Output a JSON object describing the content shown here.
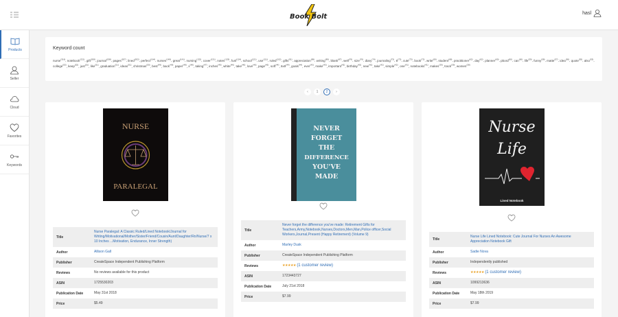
{
  "header": {
    "user_name": "hasl",
    "logo_text": "Book Bolt"
  },
  "sidebar": {
    "items": [
      {
        "label": "Products",
        "icon": "book-icon",
        "active": true
      },
      {
        "label": "Seller",
        "icon": "user-icon"
      },
      {
        "label": "Cloud",
        "icon": "cloud-icon"
      },
      {
        "label": "Favorites",
        "icon": "heart-icon"
      },
      {
        "label": "Keywords",
        "icon": "key-icon"
      }
    ]
  },
  "keyword_count": {
    "title": "Keyword count",
    "keywords": [
      [
        "nurse",
        "316"
      ],
      [
        "notebook",
        "221"
      ],
      [
        "gift",
        "208"
      ],
      [
        "journal",
        "208"
      ],
      [
        "pages",
        "207"
      ],
      [
        "lined",
        "202"
      ],
      [
        "perfect",
        "164"
      ],
      [
        "nurses",
        "149"
      ],
      [
        "great",
        "141"
      ],
      [
        "nursing",
        "132"
      ],
      [
        "cover",
        "131"
      ],
      [
        "notes",
        "129"
      ],
      [
        "funl",
        "124"
      ],
      [
        "school",
        "121"
      ],
      [
        "use",
        "111"
      ],
      [
        "ruled",
        "102"
      ],
      [
        "gifts",
        "91"
      ],
      [
        "appreciation",
        "89"
      ],
      [
        "writing",
        "89"
      ],
      [
        "blank",
        "87"
      ],
      [
        "well",
        "76"
      ],
      [
        "size",
        "76"
      ],
      [
        "diary",
        "74"
      ],
      [
        "journaling",
        "73"
      ],
      [
        "8",
        "73"
      ],
      [
        "cute",
        "73"
      ],
      [
        "book",
        "72"
      ],
      [
        "write",
        "69"
      ],
      [
        "student",
        "68"
      ],
      [
        "practitioner",
        "62"
      ],
      [
        "day",
        "62"
      ],
      [
        "planner",
        "60"
      ],
      [
        "pbord",
        "60"
      ],
      [
        "can",
        "60"
      ],
      [
        "life",
        "59"
      ],
      [
        "funny",
        "58"
      ],
      [
        "matte",
        "57"
      ],
      [
        "idea",
        "56"
      ],
      [
        "quote",
        "55"
      ],
      [
        "also",
        "53"
      ],
      [
        "college",
        "53"
      ],
      [
        "keep",
        "52"
      ],
      [
        "just",
        "51"
      ],
      [
        "like",
        "51"
      ],
      [
        "graduation",
        "51"
      ],
      [
        "ideas",
        "51"
      ],
      [
        "christmas",
        "50"
      ],
      [
        "best",
        "49"
      ],
      [
        "back",
        "49"
      ],
      [
        "paper",
        "48"
      ],
      [
        "x",
        "48"
      ],
      [
        "taking",
        "47"
      ],
      [
        "inches",
        "46"
      ],
      [
        "white",
        "46"
      ],
      [
        "take",
        "46"
      ],
      [
        "love",
        "46"
      ],
      [
        "page",
        "45"
      ],
      [
        "soft",
        "44"
      ],
      [
        "6x9",
        "44"
      ],
      [
        "goals",
        "44"
      ],
      [
        "ever",
        "43"
      ],
      [
        "make",
        "43"
      ],
      [
        "important",
        "42"
      ],
      [
        "birthday",
        "42"
      ],
      [
        "new",
        "42"
      ],
      [
        "take",
        "42"
      ],
      [
        "simple",
        "42"
      ],
      [
        "one",
        "41"
      ],
      [
        "notebooks",
        "41"
      ],
      [
        "makes",
        "39"
      ],
      [
        "track",
        "39"
      ],
      [
        "women",
        "38"
      ]
    ]
  },
  "pagination": {
    "prev": "‹",
    "page1": "1",
    "page2": "2",
    "next": "›"
  },
  "products": [
    {
      "cover_line1": "NURSE",
      "cover_line2": "PARALEGAL",
      "rows": {
        "title_label": "Title",
        "title": "Nurse Paralegal: A Classic Ruled/Lined Notebook/Journal for Writing/Motivational/Mother/Sister/Friend/Cousin/Aunt/Daughter/Rn/Nurse/7 x 10 Inches ...Motivation, Endurance, Inner Strength)",
        "author_label": "Author",
        "author": "Allison Gall",
        "publisher_label": "Publisher",
        "publisher": "CreateSpace Independent Publishing Platform",
        "reviews_label": "Reviews",
        "reviews": "No reviews available for this product",
        "asin_label": "ASIN",
        "asin": "1725530203",
        "pubdate_label": "Publication Date",
        "pubdate": "May 31st 2018",
        "price_label": "Price",
        "price": "$5.49"
      }
    },
    {
      "cover_text": "NEVER FORGET THE DIFFERENCE YOU'VE MADE",
      "rows": {
        "title_label": "Title",
        "title": "Never forget the difference you've made: Retirement Gifts for Teachers,Army,Notebook,Nurses,Doctors,Men,Man,Police officer,Social Workers,Journal,Present (Happy Retirement) (Volume 9)",
        "author_label": "Author",
        "author": "Marley Dusk",
        "publisher_label": "Publisher",
        "publisher": "CreateSpace Independent Publishing Platform",
        "reviews_label": "Reviews",
        "stars": "★★★★★",
        "review_link": "(1 customer review)",
        "asin_label": "ASIN",
        "asin": "1723443727",
        "pubdate_label": "Publication Date",
        "pubdate": "July 21st 2018",
        "price_label": "Price",
        "price": "$7.99"
      }
    },
    {
      "cover_line1": "Nurse",
      "cover_line2": "Life",
      "cover_caption": "Lined Notebook",
      "rows": {
        "title_label": "Title",
        "title": "Nurse Life Lined Notebook: Cute Journal For Nurses An Awesome Appreciation Notebook Gift",
        "author_label": "Author",
        "author": "Sadie Nova",
        "publisher_label": "Publisher",
        "publisher": "Independently published",
        "reviews_label": "Reviews",
        "stars": "★★★★★",
        "review_link": "(1 customer review)",
        "asin_label": "ASIN",
        "asin": "1099213636",
        "pubdate_label": "Publication Date",
        "pubdate": "May 18th 2019",
        "price_label": "Price",
        "price": "$7.99"
      }
    }
  ],
  "colors": {
    "accent": "#2f6db5",
    "star": "#e9a125",
    "cover1": "#0e0b0b",
    "cover2": "#4a8e9c",
    "cover3": "#1f1f1f",
    "heart_red": "#e0242f"
  }
}
